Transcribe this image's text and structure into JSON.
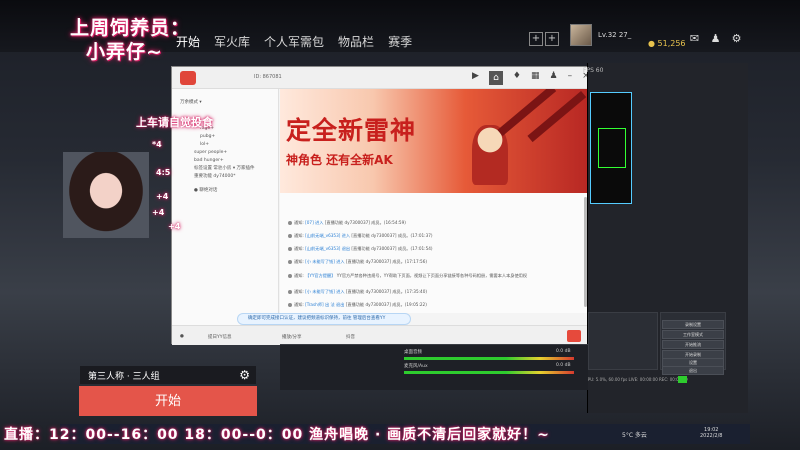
{
  "streamer_overlay": {
    "line1": "上周饲养员：",
    "line2": "小弄仔~",
    "car_text": "上车请自觉投食",
    "marquee": "直播：12：00--16：00 18：00--0：00 渔舟唱晚 · 画质不清后回家就好！~"
  },
  "game_nav": {
    "items": [
      "开始",
      "军火库",
      "个人军需包",
      "物品栏",
      "赛季"
    ]
  },
  "player": {
    "level": "Lv.32 27_",
    "coins": "51,256"
  },
  "chat_window": {
    "room_id": "ID: 867081",
    "banner_title": "定全新雷神",
    "banner_sub": "神角色 还有全新AK",
    "side_rows": [
      "万余模式 ▾",
      "rage+",
      "pubg+",
      "lol+",
      "super people+",
      "bad hunger+",
      "标签设置 常驻小房 ▾ 万家插件",
      "重要功能 dy74000*",
      "● 聊绝对话"
    ],
    "messages": [
      {
        "user": "[07] 进入",
        "text": "[直播功能 dy7300037] 成员。(16:54:59)"
      },
      {
        "user": "[山前无端_v6353] 进入",
        "text": "[直播功能 dy7300037] 成员。(17:01:37)"
      },
      {
        "user": "[山前无端_v6353] 退出",
        "text": "[直播功能 dy7300037] 成员。(17:01:54)"
      },
      {
        "user": "[小 未能写了钱] 进入",
        "text": "[直播功能 dy7300037] 成员。(17:17:56)"
      },
      {
        "user": "【YY官方提醒】",
        "text": "YY官方严禁各种违规号，YY帮助下页面，视频让下页面分享链接等各种号码相册，需要本人本身使用权"
      },
      {
        "user": "[小 未能写了钱] 进入",
        "text": "[直播功能 dy7300037] 成员。(17:35:40)"
      },
      {
        "user": "[Trash师] 出 法 退出",
        "text": "[直播功能 dy7300037] 成员。(19:05:22)"
      }
    ],
    "notice": "确定即可完成接口认证，建议把频道标识保持，前往 管理后台查看YY",
    "footer": {
      "left": "提日YY信息",
      "mid": "播放/分享",
      "right": "抖音"
    }
  },
  "overlay_gifts": [
    {
      "label": "*4"
    },
    {
      "label": "4:5"
    },
    {
      "label": "+4"
    },
    {
      "label": "+4"
    },
    {
      "label": "+4"
    }
  ],
  "obs": {
    "fps": "FPS 60",
    "panels": [
      "录制设置",
      "工作室模式",
      "开始推流",
      "开始录制",
      "设置",
      "退出"
    ],
    "status": "CPU: 5.0%, 60.00 fps   LIVE: 00:00:00   REC: 00:00:00",
    "mixer": [
      {
        "name": "桌面音频",
        "value": "0.0 dB"
      },
      {
        "name": "麦克风/Aux",
        "value": "0.0 dB"
      }
    ]
  },
  "mode": {
    "label": "第三人称 · 三人组",
    "start": "开始"
  },
  "taskbar": {
    "weather": "5°C 多云",
    "time": "19:02",
    "date": "2022/2/8"
  }
}
